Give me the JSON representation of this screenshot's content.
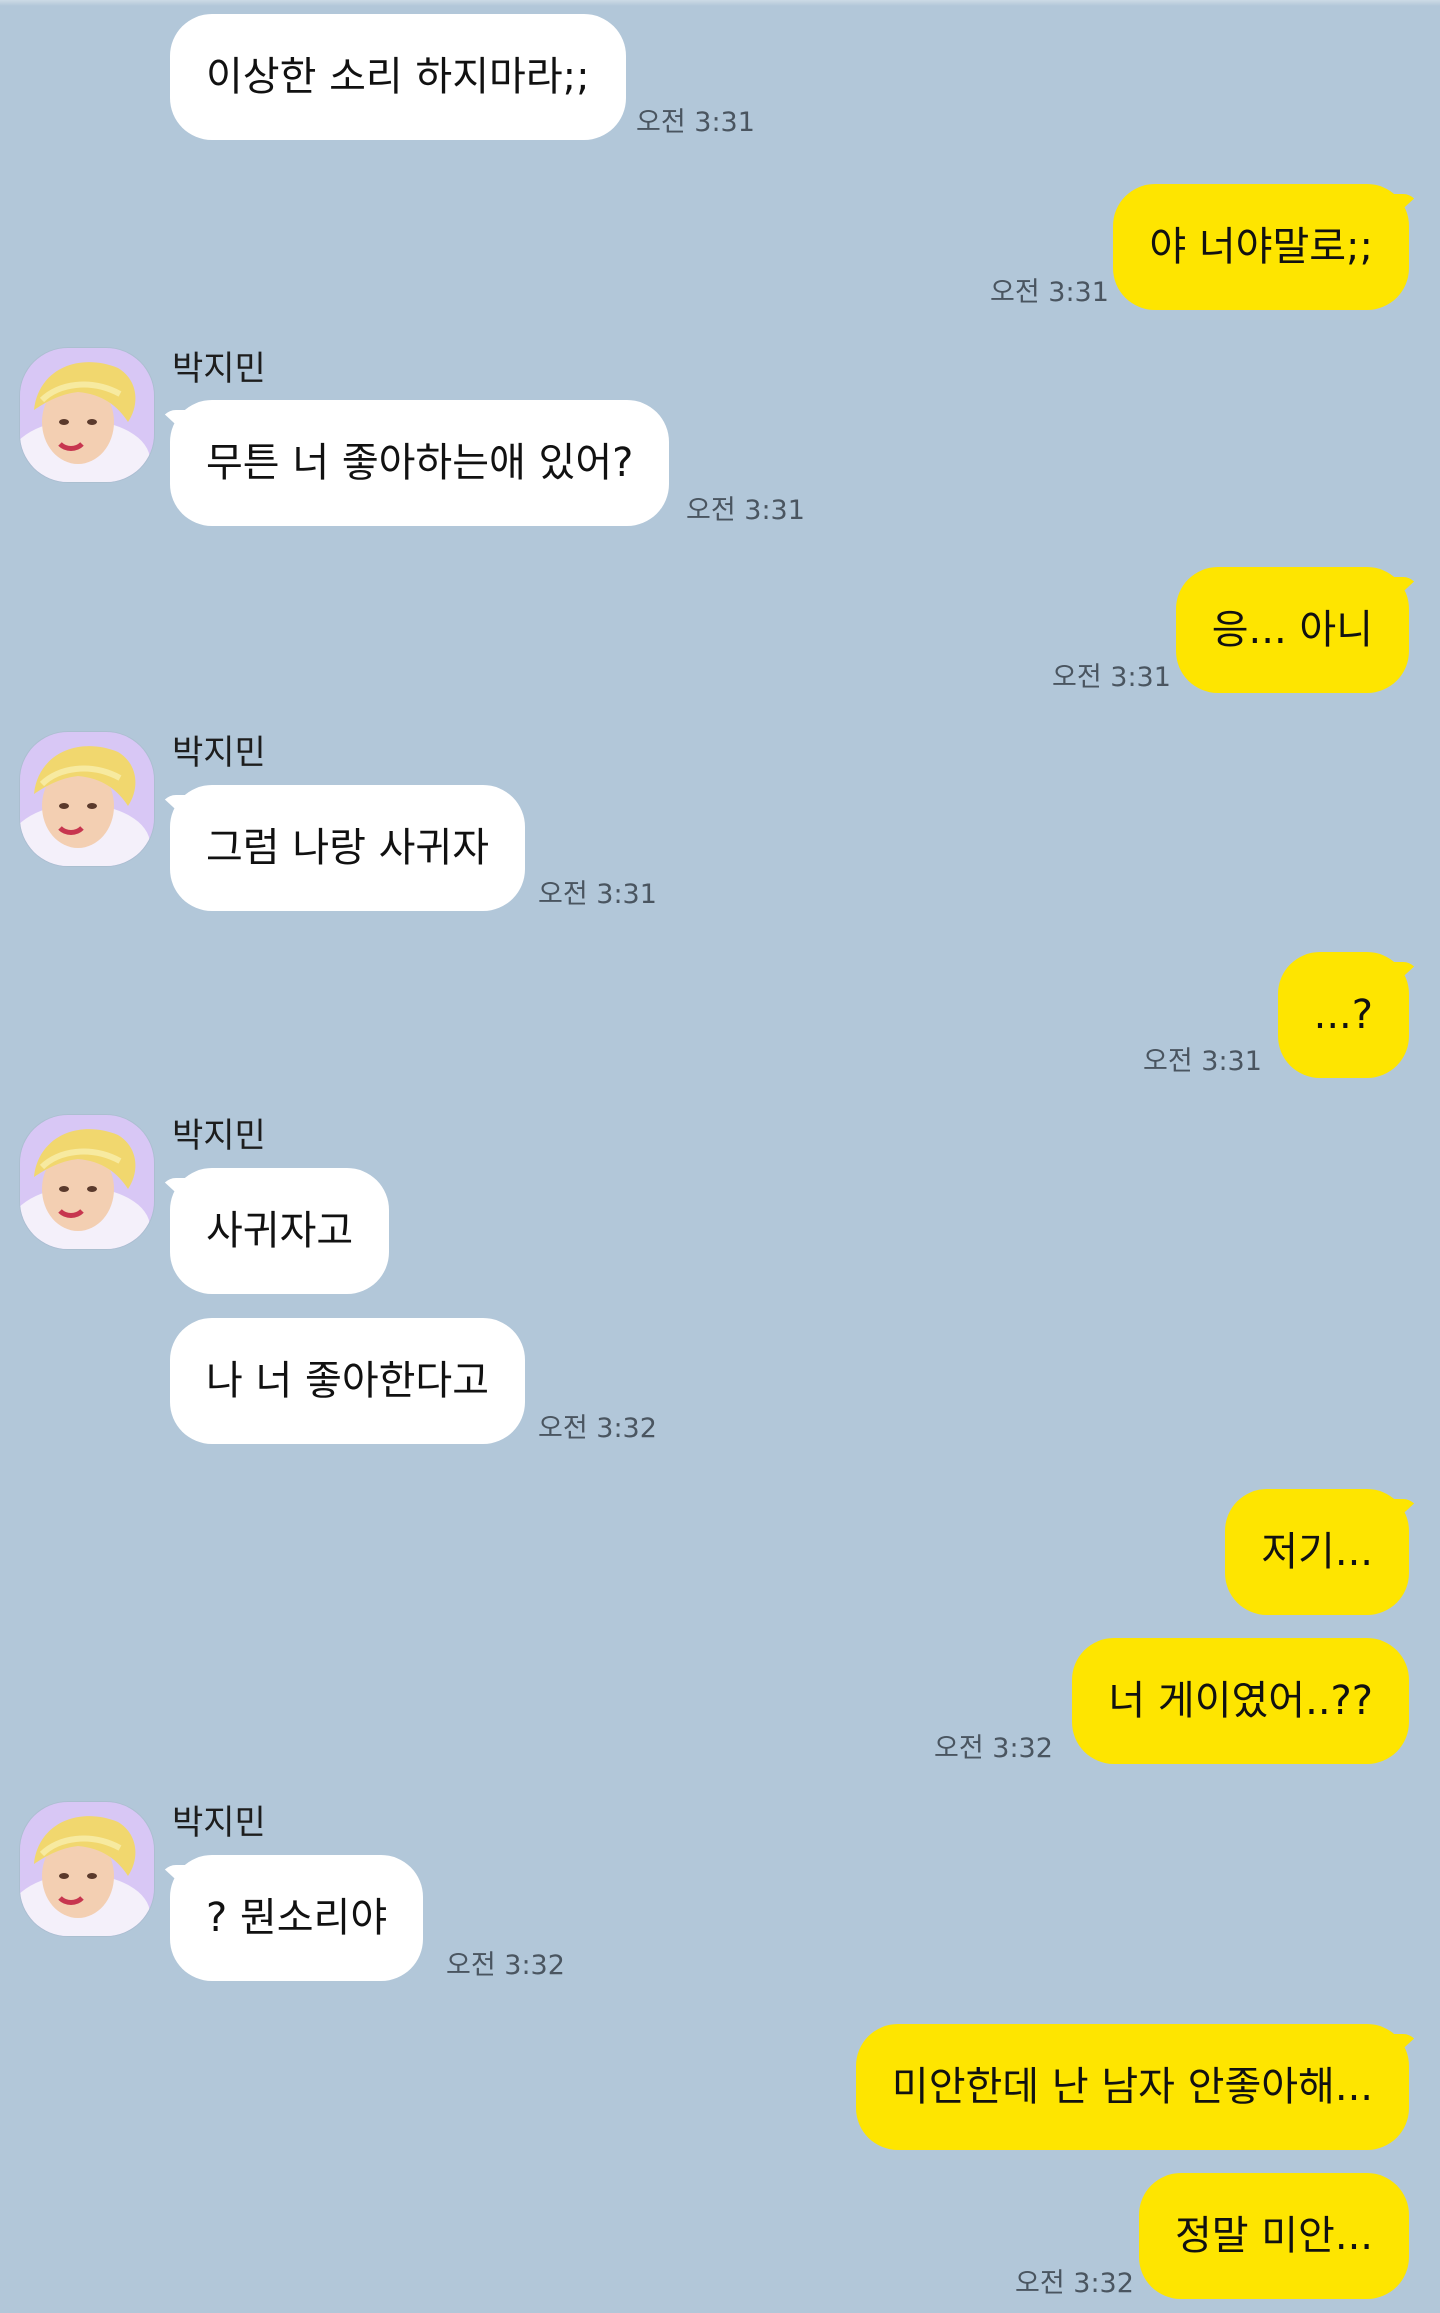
{
  "chat": {
    "sender_name": "박지민",
    "avatar_icon": "profile-photo",
    "colors": {
      "background": "#b2c7d9",
      "incoming_bubble": "#ffffff",
      "outgoing_bubble": "#fee500"
    },
    "messages": [
      {
        "text": "이상한 소리 하지마라;;",
        "time": "오전 3:31"
      },
      {
        "text": "야 너야말로;;",
        "time": "오전 3:31"
      },
      {
        "text": "무튼 너 좋아하는애 있어?",
        "time": "오전 3:31"
      },
      {
        "text": "응... 아니",
        "time": "오전 3:31"
      },
      {
        "text": "그럼 나랑 사귀자",
        "time": "오전 3:31"
      },
      {
        "text": "...?",
        "time": "오전 3:31"
      },
      {
        "text": "사귀자고"
      },
      {
        "text": "나 너 좋아한다고",
        "time": "오전 3:32"
      },
      {
        "text": "저기..."
      },
      {
        "text": "너 게이였어..??",
        "time": "오전 3:32"
      },
      {
        "text": "? 뭔소리야",
        "time": "오전 3:32"
      },
      {
        "text": "미안한데 난 남자 안좋아해..."
      },
      {
        "text": "정말 미안...",
        "time": "오전 3:32"
      }
    ]
  }
}
